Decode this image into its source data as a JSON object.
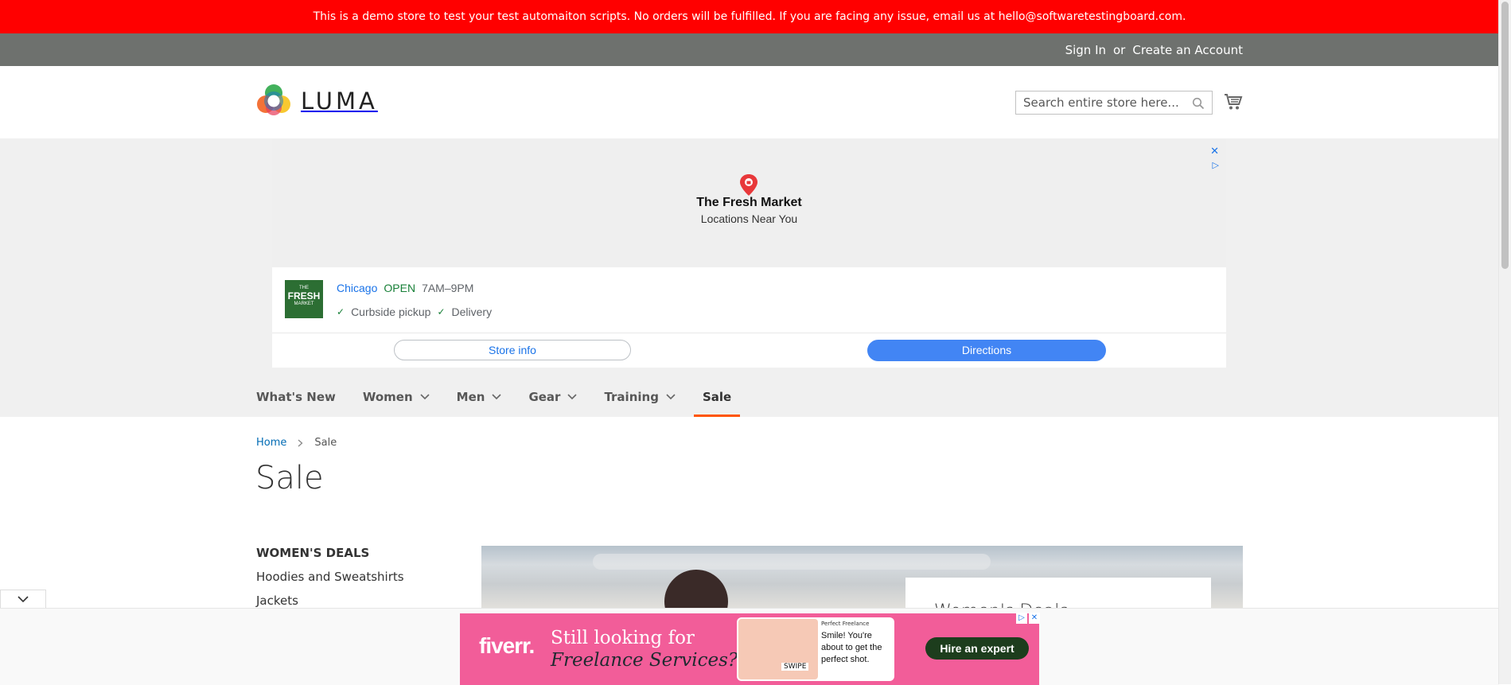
{
  "demo_notice": "This is a demo store to test your test automaiton scripts. No orders will be fulfilled. If you are facing any issue, email us at hello@softwaretestingboard.com.",
  "header_links": {
    "sign_in": "Sign In",
    "or": "or",
    "create_account": "Create an Account"
  },
  "logo": {
    "text": "LUMA"
  },
  "search": {
    "placeholder": "Search entire store here..."
  },
  "ad_banner": {
    "title": "The Fresh Market",
    "subtitle": "Locations Near You",
    "store_logo_lines": [
      "THE",
      "FRESH",
      "MARKET"
    ],
    "city": "Chicago",
    "status": "OPEN",
    "hours": "7AM–9PM",
    "features": [
      "Curbside pickup",
      "Delivery"
    ],
    "store_info_button": "Store info",
    "directions_button": "Directions"
  },
  "nav": {
    "items": [
      {
        "label": "What's New",
        "has_dropdown": false
      },
      {
        "label": "Women",
        "has_dropdown": true
      },
      {
        "label": "Men",
        "has_dropdown": true
      },
      {
        "label": "Gear",
        "has_dropdown": true
      },
      {
        "label": "Training",
        "has_dropdown": true
      },
      {
        "label": "Sale",
        "has_dropdown": false,
        "active": true
      }
    ]
  },
  "breadcrumbs": {
    "home": "Home",
    "current": "Sale"
  },
  "page_title": "Sale",
  "sidebar": {
    "title": "WOMEN'S DEALS",
    "links": [
      "Hoodies and Sweatshirts",
      "Jackets"
    ]
  },
  "promo_banner": {
    "title": "Women's Deals"
  },
  "bottom_ad": {
    "brand": "fiverr.",
    "headline_1": "Still looking for",
    "headline_2": "Freelance Services?",
    "tag": "Perfect Freelance",
    "message": "Smile! You're about to get the perfect shot.",
    "swipe": "SWIPE",
    "cta": "Hire an expert"
  },
  "colors": {
    "demo_bar": "#ff0000",
    "top_bar": "#6e716e",
    "link": "#006bb4",
    "active_nav": "#ff5501",
    "directions_button": "#4285f4",
    "fiverr_bg": "#f25d99"
  }
}
